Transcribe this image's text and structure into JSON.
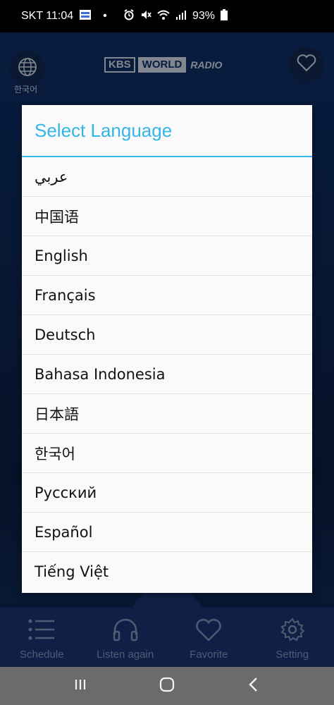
{
  "status_bar": {
    "carrier_time": "SKT 11:04",
    "dot": "•",
    "battery_pct": "93%"
  },
  "header": {
    "language_label": "한국어",
    "logo": {
      "part1": "KBS",
      "part2": "WORLD",
      "part3": "RADIO"
    }
  },
  "dialog": {
    "title": "Select Language",
    "languages": [
      "عربي",
      "中国语",
      "English",
      "Français",
      "Deutsch",
      "Bahasa Indonesia",
      "日本語",
      "한국어",
      "Русский",
      "Español",
      "Tiếng Việt"
    ]
  },
  "bottom_nav": {
    "items": [
      {
        "label": "Schedule",
        "icon": "list-icon"
      },
      {
        "label": "Listen again",
        "icon": "headphones-icon"
      },
      {
        "label": "Favorite",
        "icon": "heart-icon"
      },
      {
        "label": "Setting",
        "icon": "gear-icon"
      }
    ]
  },
  "colors": {
    "accent": "#33b5e5",
    "app_background": "#0b2a5a",
    "nav_background": "#17306a"
  }
}
